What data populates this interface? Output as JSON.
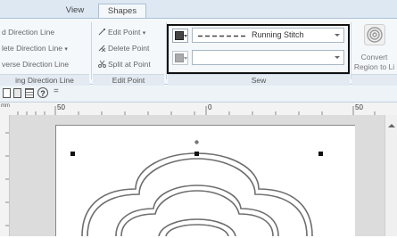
{
  "tabs": [
    {
      "label": "View",
      "active": false
    },
    {
      "label": "Shapes",
      "active": true
    }
  ],
  "ribbon": {
    "direction_group": {
      "items": [
        "d Direction Line",
        "lete Direction Line",
        "verse Direction Line"
      ],
      "label": "ing Direction Line"
    },
    "edit_point_group": {
      "items": [
        "Edit Point",
        "Delete Point",
        "Split at Point"
      ],
      "label": "Edit Point"
    },
    "sew_group": {
      "stitch_type": "Running Stitch",
      "fill_value": "",
      "label": "Sew"
    },
    "convert_group": {
      "line1": "Convert",
      "line2": "Region to Li"
    }
  },
  "toolbar": {
    "help_glyph": "?",
    "overflow_glyph": "="
  },
  "ruler": {
    "unit_label": "mm",
    "ticks": [
      "50",
      "0",
      "50"
    ]
  },
  "colors": {
    "ribbon_bg": "#f5f8fb",
    "tab_strip": "#dde8f3",
    "workspace": "#dcdcdc",
    "outline_stroke": "#6e6e6e",
    "handle": "#111111"
  }
}
